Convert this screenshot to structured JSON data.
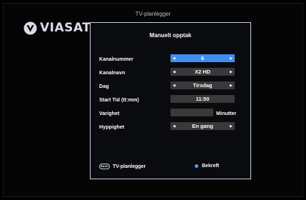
{
  "header": {
    "title": "TV-planlegger"
  },
  "brand": {
    "name": "VIASAT",
    "icon": "viasat-logo-icon"
  },
  "dialog": {
    "title": "Manuelt opptak",
    "rows": [
      {
        "label": "Kanalnummer",
        "value": "6"
      },
      {
        "label": "Kanalnavn",
        "value": "X2 HD"
      },
      {
        "label": "Dag",
        "value": "Tirsdag"
      },
      {
        "label": "Start Tid (tt:mm)",
        "value": "11:50"
      },
      {
        "label": "Varighet",
        "value": "",
        "unit": "Minutter"
      },
      {
        "label": "Hyppighet",
        "value": "En gang"
      }
    ],
    "footer": {
      "back_key": "BACK",
      "back_label": "TV-planlegger",
      "confirm_label": "Bekreft"
    }
  },
  "colors": {
    "accent": "#3f8ff1",
    "field": "#393939",
    "border": "#c9d1df",
    "confirm_dot": "#4aa3f5"
  }
}
